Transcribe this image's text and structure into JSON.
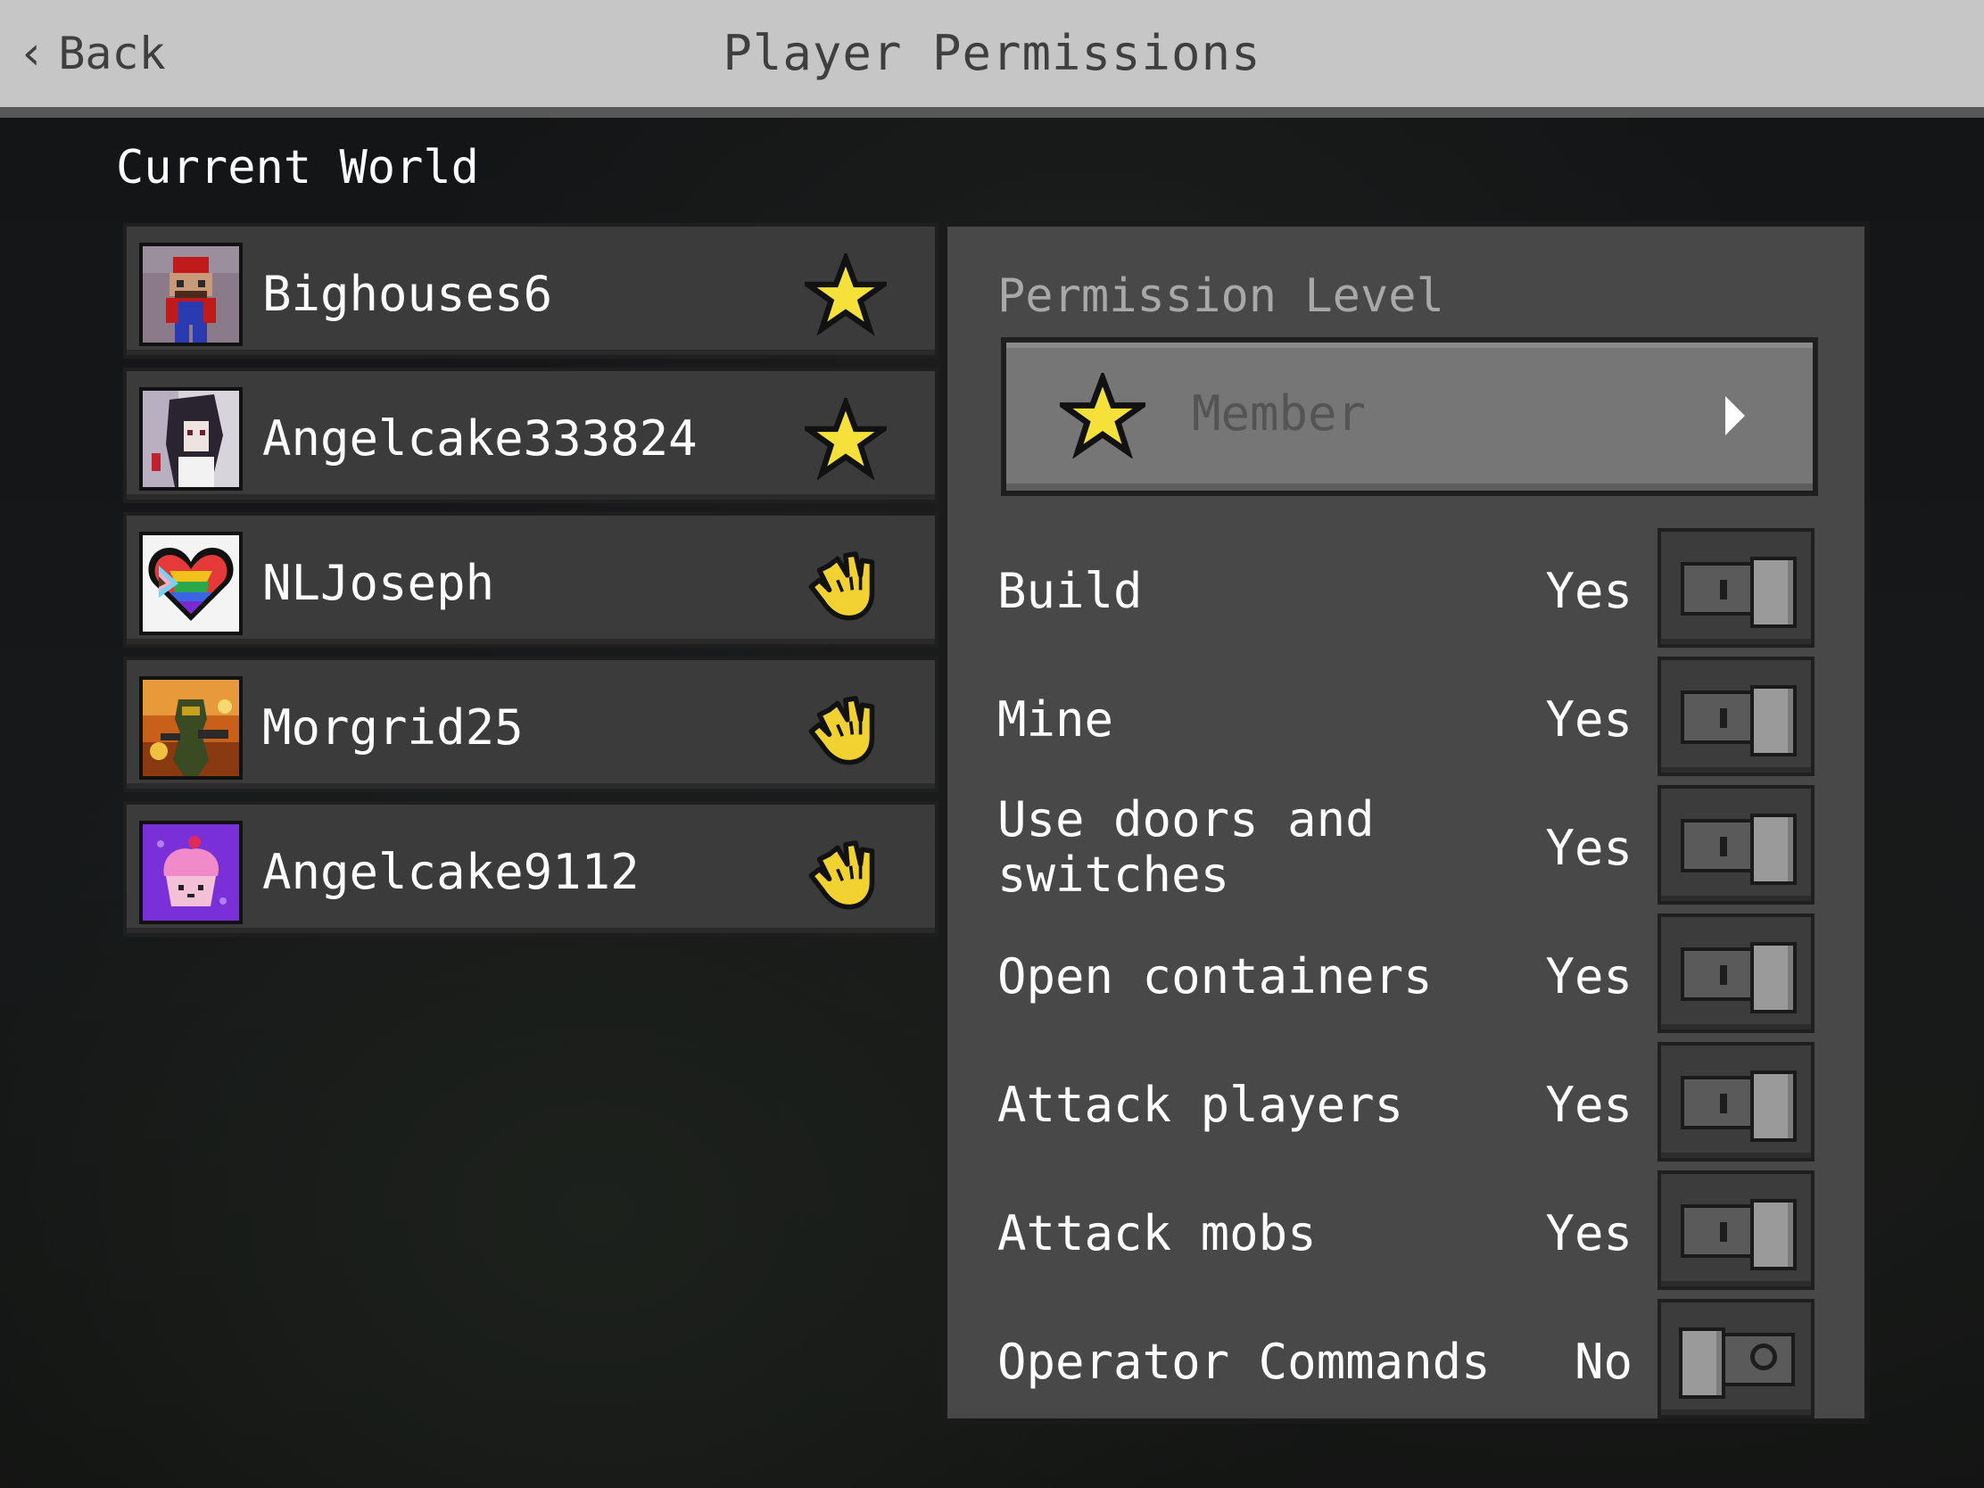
{
  "header": {
    "back_label": "Back",
    "title": "Player Permissions"
  },
  "section_title": "Current World",
  "players": [
    {
      "name": "Bighouses6",
      "role_icon": "star-icon",
      "selected": true
    },
    {
      "name": "Angelcake333824",
      "role_icon": "star-icon",
      "selected": false
    },
    {
      "name": "NLJoseph",
      "role_icon": "hand-icon",
      "selected": false
    },
    {
      "name": "Morgrid25",
      "role_icon": "hand-icon",
      "selected": false
    },
    {
      "name": "Angelcake9112",
      "role_icon": "hand-icon",
      "selected": false
    }
  ],
  "permission_panel": {
    "level_label": "Permission Level",
    "level_value": "Member",
    "permissions": [
      {
        "label": "Build",
        "state": "Yes",
        "enabled": true
      },
      {
        "label": "Mine",
        "state": "Yes",
        "enabled": true
      },
      {
        "label": "Use doors and switches",
        "state": "Yes",
        "enabled": true
      },
      {
        "label": "Open containers",
        "state": "Yes",
        "enabled": true
      },
      {
        "label": "Attack players",
        "state": "Yes",
        "enabled": true
      },
      {
        "label": "Attack mobs",
        "state": "Yes",
        "enabled": true
      },
      {
        "label": "Operator Commands",
        "state": "No",
        "enabled": false
      }
    ]
  },
  "colors": {
    "header_bg": "#c6c6c6",
    "panel_bg": "#484848",
    "row_bg": "#3b3b3b",
    "star": "#f5e13a",
    "hand": "#f2d230"
  }
}
